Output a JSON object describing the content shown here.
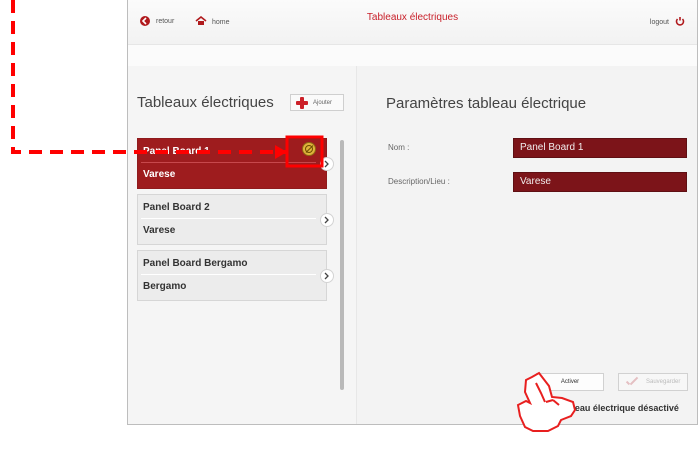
{
  "header": {
    "back_label": "retour",
    "home_label": "home",
    "title": "Tableaux électriques",
    "logout_label": "logout"
  },
  "left": {
    "heading": "Tableaux électriques",
    "add_label": "Ajouter",
    "panels": [
      {
        "name": "Panel Board 1",
        "location": "Varese",
        "active": true
      },
      {
        "name": "Panel Board 2",
        "location": "Varese",
        "active": false
      },
      {
        "name": "Panel Board Bergamo",
        "location": "Bergamo",
        "active": false
      }
    ]
  },
  "right": {
    "heading": "Paramètres tableau électrique",
    "fields": {
      "name_label": "Nom :",
      "name_value": "Panel Board 1",
      "desc_label": "Description/Lieu :",
      "desc_value": "Varese"
    },
    "buttons": {
      "activate": "Activer",
      "save": "Sauvegarder"
    },
    "status": "Tableau électrique désactivé"
  },
  "colors": {
    "accent": "#c8202a",
    "selected_row": "#9e1c1e",
    "field_bg": "#7c1419",
    "overlay_red": "#ff0000"
  },
  "icons": {
    "back": "back-arrow-icon",
    "home": "home-icon",
    "logout": "power-icon",
    "add": "plus-icon",
    "disable": "disabled-icon",
    "chevron": "chevron-right-icon",
    "save": "check-icon",
    "hand": "hand-pointer-icon"
  }
}
